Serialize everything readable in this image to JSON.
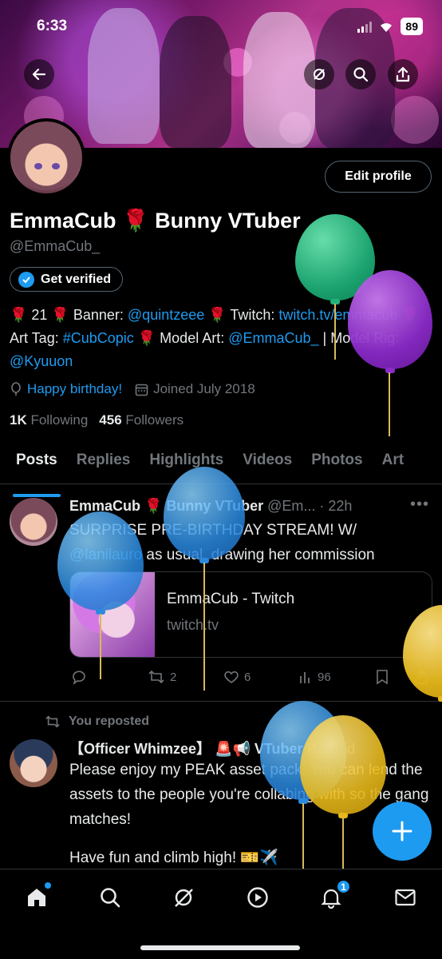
{
  "status_bar": {
    "time": "6:33",
    "battery": "89"
  },
  "profile": {
    "name": "EmmaCub 🌹 Bunny VTuber",
    "handle": "@EmmaCub_",
    "edit_profile_label": "Edit profile",
    "get_verified_label": "Get verified",
    "bio": {
      "p1": "🌹 21 🌹 Banner: ",
      "link1": "@quintzeee",
      "p2": " 🌹 Twitch: ",
      "link2": "twitch.tv/emmacub",
      "p3": " 🌹 Art Tag: ",
      "link3": "#CubCopic",
      "p4": " 🌹 Model Art: ",
      "link4": "@EmmaCub_",
      "p5": " | Model Rig: ",
      "link5": "@Kyuuon"
    },
    "birthday_text": "Happy birthday!",
    "joined_text": "Joined July 2018",
    "following_count": "1K",
    "following_label": "Following",
    "followers_count": "456",
    "followers_label": "Followers"
  },
  "tabs": [
    {
      "label": "Posts"
    },
    {
      "label": "Replies"
    },
    {
      "label": "Highlights"
    },
    {
      "label": "Videos"
    },
    {
      "label": "Photos"
    },
    {
      "label": "Art"
    }
  ],
  "tweets": [
    {
      "name": "EmmaCub 🌹 Bunny VTuber",
      "handle_time": "@Em... · 22h",
      "text_p1": "SURPRISE PRE-BIRTHDAY STREAM! W/ ",
      "text_link": "@lanilauro",
      "text_p2": " as usual, drawing her commission",
      "card_title": "EmmaCub - Twitch",
      "card_domain": "twitch.tv",
      "retweets": "2",
      "likes": "6",
      "views": "96"
    },
    {
      "repost_label": "You reposted",
      "name": "【Officer Whimzee】 🚨📢 VTuber P...",
      "handle_time": "· 5d",
      "text_l1": "Please enjoy my PEAK asset pack! You can lend the assets to the people you're collabing with so the gang matches!",
      "text_l2": "Have fun and climb high! 🎫✈️"
    }
  ],
  "nav": {
    "notification_count": "1"
  },
  "colors": {
    "accent": "#1d9bf0",
    "background": "#000000",
    "muted": "#71767b"
  },
  "icons": [
    "back-arrow-icon",
    "no-signal-icon",
    "search-icon",
    "share-icon",
    "verified-badge-icon",
    "balloon-icon",
    "calendar-icon",
    "reply-icon",
    "retweet-icon",
    "like-icon",
    "views-icon",
    "bookmark-icon",
    "home-icon",
    "grok-icon",
    "play-icon",
    "bell-icon",
    "mail-icon",
    "plus-icon"
  ]
}
